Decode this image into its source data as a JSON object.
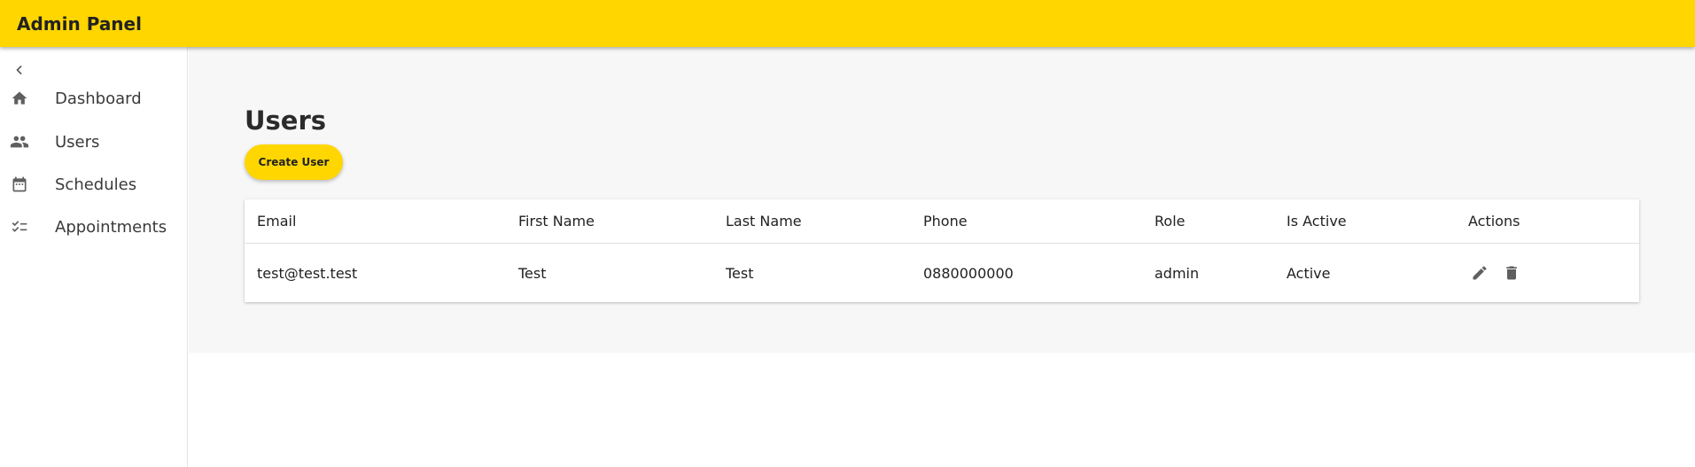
{
  "app": {
    "title": "Admin Panel"
  },
  "colors": {
    "accent": "#FFD600",
    "main_bg": "#F7F7F7",
    "icon": "#5f5f5f"
  },
  "sidebar": {
    "collapse_icon": "chevron-left-icon",
    "items": [
      {
        "label": "Dashboard",
        "icon": "home-icon"
      },
      {
        "label": "Users",
        "icon": "people-icon"
      },
      {
        "label": "Schedules",
        "icon": "calendar-icon"
      },
      {
        "label": "Appointments",
        "icon": "checklist-icon"
      }
    ]
  },
  "main": {
    "title": "Users",
    "create_button": "Create User",
    "table": {
      "columns": [
        "Email",
        "First Name",
        "Last Name",
        "Phone",
        "Role",
        "Is Active",
        "Actions"
      ],
      "rows": [
        {
          "email": "test@test.test",
          "first_name": "Test",
          "last_name": "Test",
          "phone": "0880000000",
          "role": "admin",
          "is_active": "Active",
          "actions": [
            "edit-icon",
            "delete-icon"
          ]
        }
      ]
    }
  }
}
